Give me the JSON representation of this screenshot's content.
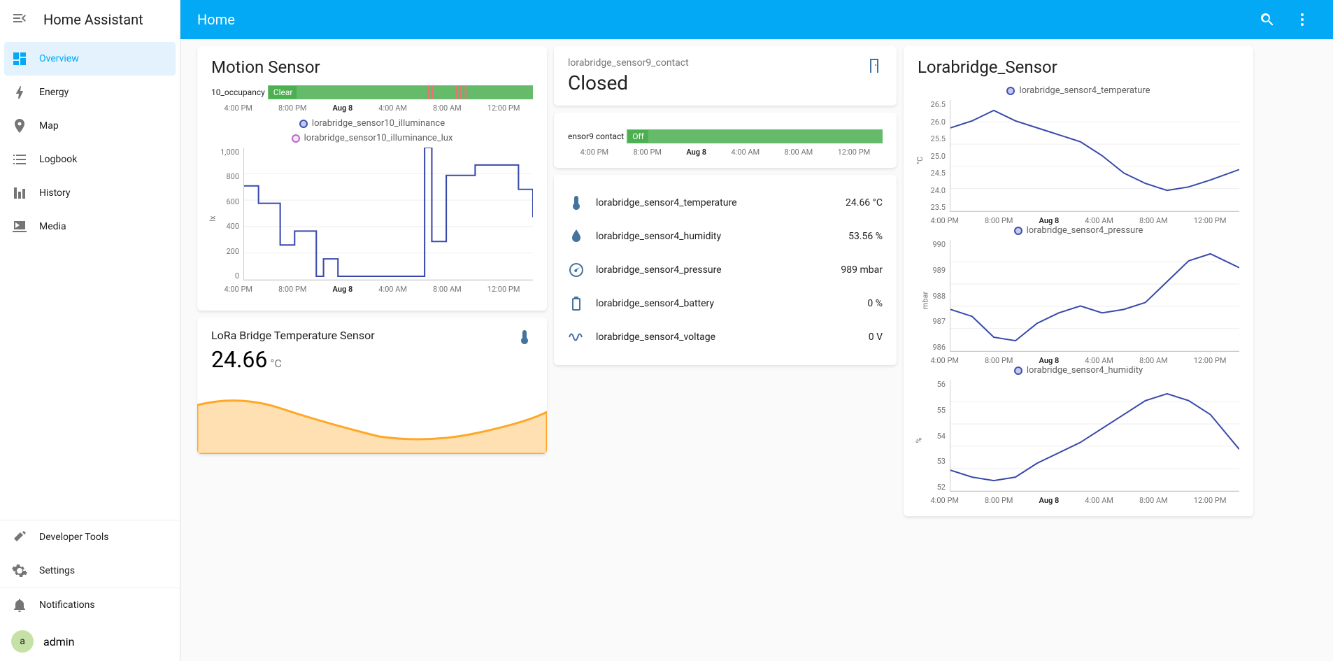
{
  "app_title": "Home Assistant",
  "header": {
    "title": "Home"
  },
  "sidebar": {
    "items": [
      {
        "label": "Overview"
      },
      {
        "label": "Energy"
      },
      {
        "label": "Map"
      },
      {
        "label": "Logbook"
      },
      {
        "label": "History"
      },
      {
        "label": "Media"
      }
    ],
    "footer": [
      {
        "label": "Developer Tools"
      },
      {
        "label": "Settings"
      }
    ],
    "notifications_label": "Notifications",
    "user": {
      "initial": "a",
      "name": "admin"
    }
  },
  "time_labels": [
    "4:00 PM",
    "8:00 PM",
    "Aug 8",
    "4:00 AM",
    "8:00 AM",
    "12:00 PM"
  ],
  "motion_card": {
    "title": "Motion Sensor",
    "occupancy_label": "10_occupancy",
    "occupancy_state": "Clear",
    "legend1": "lorabridge_sensor10_illuminance",
    "legend2": "lorabridge_sensor10_illuminance_lux",
    "y_label": "lx",
    "y_ticks": [
      "1,000",
      "800",
      "600",
      "400",
      "200",
      "0"
    ]
  },
  "temp_card": {
    "title": "LoRa Bridge Temperature Sensor",
    "value": "24.66",
    "unit": "°C"
  },
  "contact_card": {
    "subtitle": "lorabridge_sensor9_contact",
    "state": "Closed",
    "status_label": "ensor9 contact",
    "status_state": "Off"
  },
  "entity_rows": [
    {
      "name": "lorabridge_sensor4_temperature",
      "value": "24.66 °C"
    },
    {
      "name": "lorabridge_sensor4_humidity",
      "value": "53.56 %"
    },
    {
      "name": "lorabridge_sensor4_pressure",
      "value": "989 mbar"
    },
    {
      "name": "lorabridge_sensor4_battery",
      "value": "0 %"
    },
    {
      "name": "lorabridge_sensor4_voltage",
      "value": "0 V"
    }
  ],
  "sensor4_card": {
    "title": "Lorabridge_Sensor",
    "chart1": {
      "legend": "lorabridge_sensor4_temperature",
      "y_label": "°C",
      "y_ticks": [
        "26.5",
        "26.0",
        "25.5",
        "25.0",
        "24.5",
        "24.0",
        "23.5"
      ]
    },
    "chart2": {
      "legend": "lorabridge_sensor4_pressure",
      "y_label": "mbar",
      "y_ticks": [
        "990",
        "989",
        "988",
        "987",
        "986"
      ]
    },
    "chart3": {
      "legend": "lorabridge_sensor4_humidity",
      "y_label": "%",
      "y_ticks": [
        "56",
        "55",
        "54",
        "53",
        "52"
      ]
    }
  },
  "chart_data": [
    {
      "type": "line",
      "title": "Motion Sensor — Illuminance",
      "x": [
        "4:00 PM",
        "8:00 PM",
        "Aug 8",
        "4:00 AM",
        "8:00 AM",
        "12:00 PM"
      ],
      "series": [
        {
          "name": "lorabridge_sensor10_illuminance",
          "values": [
            700,
            250,
            10,
            10,
            980,
            850
          ]
        }
      ],
      "ylabel": "lx",
      "ylim": [
        0,
        1000
      ]
    },
    {
      "type": "area",
      "title": "LoRa Bridge Temperature Sensor",
      "x": [
        "4:00 PM",
        "8:00 PM",
        "Aug 8",
        "4:00 AM",
        "8:00 AM",
        "12:00 PM"
      ],
      "values": [
        26.0,
        25.0,
        24.3,
        23.8,
        24.0,
        25.0
      ],
      "ylabel": "°C"
    },
    {
      "type": "line",
      "title": "lorabridge_sensor4_temperature",
      "x": [
        "4:00 PM",
        "8:00 PM",
        "Aug 8",
        "4:00 AM",
        "8:00 AM",
        "12:00 PM"
      ],
      "values": [
        26.0,
        25.4,
        25.0,
        24.2,
        23.8,
        24.6
      ],
      "ylabel": "°C",
      "ylim": [
        23.5,
        26.5
      ]
    },
    {
      "type": "line",
      "title": "lorabridge_sensor4_pressure",
      "x": [
        "4:00 PM",
        "8:00 PM",
        "Aug 8",
        "4:00 AM",
        "8:00 AM",
        "12:00 PM"
      ],
      "values": [
        987.2,
        986.3,
        987.4,
        987.3,
        988.5,
        989.0
      ],
      "ylabel": "mbar",
      "ylim": [
        986,
        990
      ]
    },
    {
      "type": "line",
      "title": "lorabridge_sensor4_humidity",
      "x": [
        "4:00 PM",
        "8:00 PM",
        "Aug 8",
        "4:00 AM",
        "8:00 AM",
        "12:00 PM"
      ],
      "values": [
        52.6,
        52.4,
        53.2,
        54.5,
        55.4,
        53.5
      ],
      "ylabel": "%",
      "ylim": [
        52,
        56
      ]
    }
  ]
}
